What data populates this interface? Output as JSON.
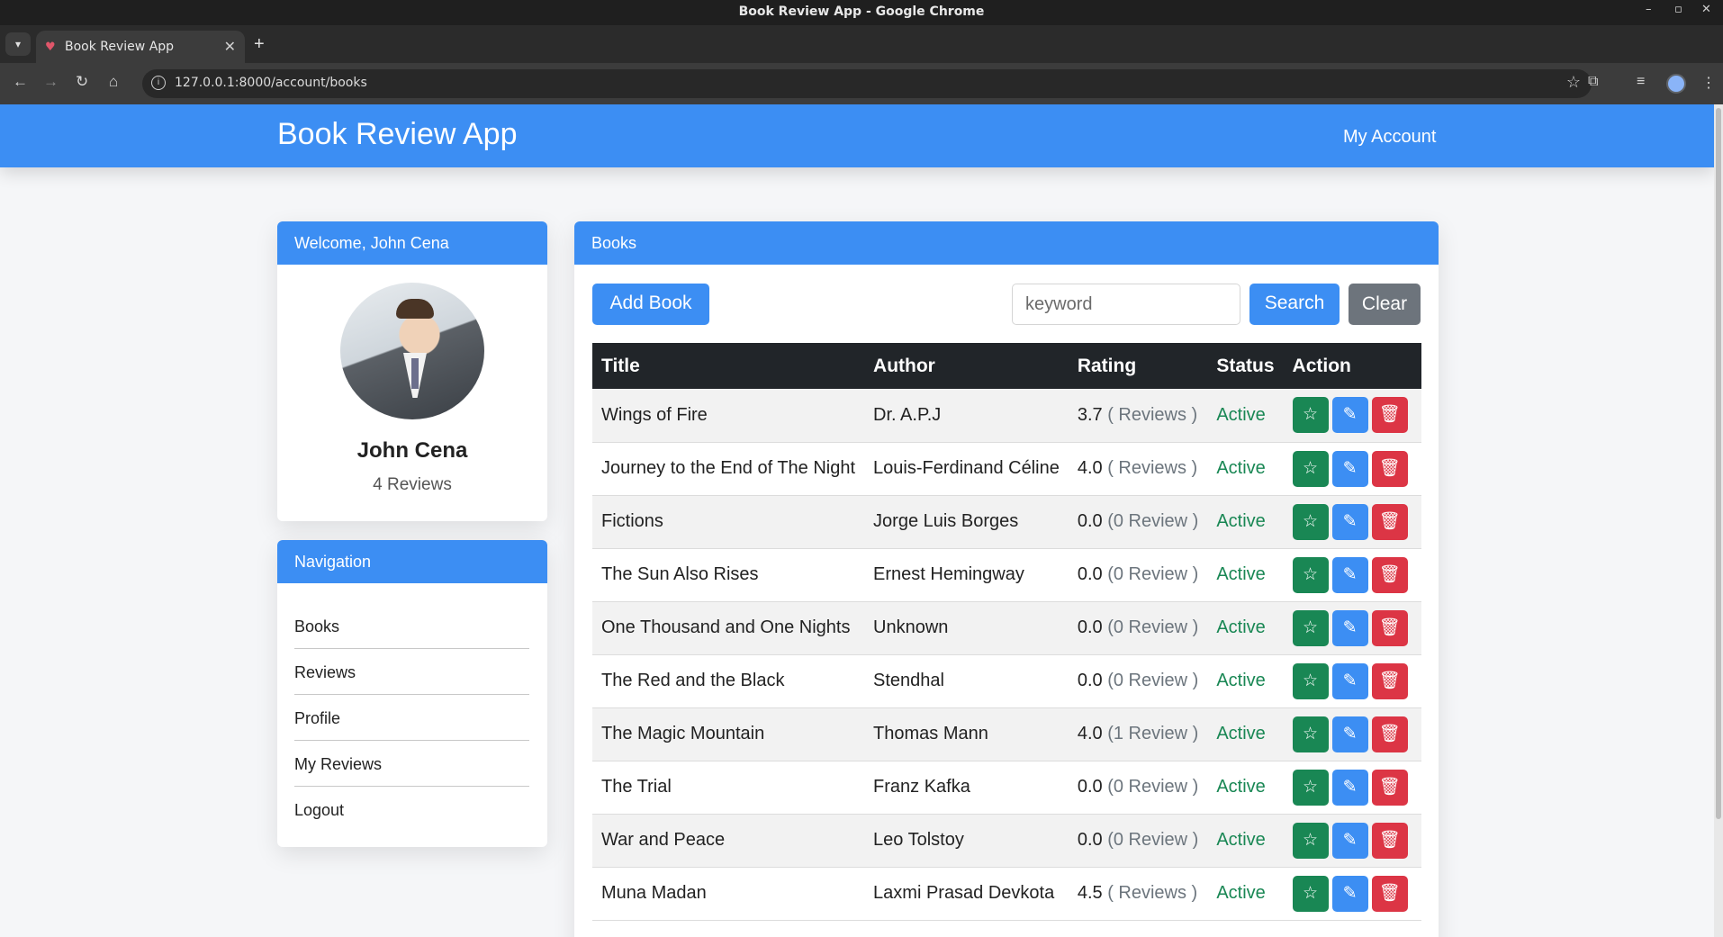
{
  "browser": {
    "window_title": "Book Review App - Google Chrome",
    "tab_title": "Book Review App",
    "url": "127.0.0.1:8000/account/books"
  },
  "app": {
    "brand": "Book Review App",
    "my_account": "My Account"
  },
  "profile": {
    "header": "Welcome, John Cena",
    "name": "John Cena",
    "reviews": "4 Reviews"
  },
  "navigation": {
    "header": "Navigation",
    "items": [
      {
        "label": "Books"
      },
      {
        "label": "Reviews"
      },
      {
        "label": "Profile"
      },
      {
        "label": "My Reviews"
      },
      {
        "label": "Logout"
      }
    ]
  },
  "books": {
    "header": "Books",
    "add_label": "Add Book",
    "search_placeholder": "keyword",
    "search_label": "Search",
    "clear_label": "Clear",
    "columns": [
      "Title",
      "Author",
      "Rating",
      "Status",
      "Action"
    ],
    "rows": [
      {
        "title": "Wings of Fire",
        "author": "Dr. A.P.J",
        "rating": "3.7",
        "reviews": "( Reviews )",
        "status": "Active"
      },
      {
        "title": "Journey to the End of The Night",
        "author": "Louis-Ferdinand Céline",
        "rating": "4.0",
        "reviews": "( Reviews )",
        "status": "Active"
      },
      {
        "title": "Fictions",
        "author": "Jorge Luis Borges",
        "rating": "0.0",
        "reviews": "(0 Review )",
        "status": "Active"
      },
      {
        "title": "The Sun Also Rises",
        "author": "Ernest Hemingway",
        "rating": "0.0",
        "reviews": "(0 Review )",
        "status": "Active"
      },
      {
        "title": "One Thousand and One Nights",
        "author": "Unknown",
        "rating": "0.0",
        "reviews": "(0 Review )",
        "status": "Active"
      },
      {
        "title": "The Red and the Black",
        "author": "Stendhal",
        "rating": "0.0",
        "reviews": "(0 Review )",
        "status": "Active"
      },
      {
        "title": "The Magic Mountain",
        "author": "Thomas Mann",
        "rating": "4.0",
        "reviews": "(1 Review )",
        "status": "Active"
      },
      {
        "title": "The Trial",
        "author": "Franz Kafka",
        "rating": "0.0",
        "reviews": "(0 Review )",
        "status": "Active"
      },
      {
        "title": "War and Peace",
        "author": "Leo Tolstoy",
        "rating": "0.0",
        "reviews": "(0 Review )",
        "status": "Active"
      },
      {
        "title": "Muna Madan",
        "author": "Laxmi Prasad Devkota",
        "rating": "4.5",
        "reviews": "( Reviews )",
        "status": "Active"
      }
    ]
  },
  "colors": {
    "primary": "#3c8ef3",
    "success": "#198754",
    "danger": "#dc3545",
    "secondary": "#6d747c",
    "table_header": "#212529"
  }
}
